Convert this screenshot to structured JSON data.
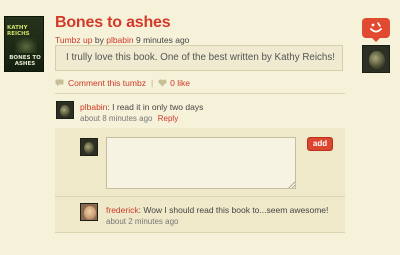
{
  "book": {
    "author_cover": "KATHY REICHS",
    "title_cover": "BONES TO ASHES"
  },
  "post": {
    "title": "Bones to ashes",
    "byline_prefix": "Tumbz up",
    "byline_by": "by",
    "byline_user": "plbabin",
    "byline_time": "9 minutes ago",
    "quote": "I trully love this book. One of the best written by Kathy Reichs!"
  },
  "actions": {
    "comment_label": "Comment this tumbz",
    "like_label": "0 like"
  },
  "comments": [
    {
      "author": "plbabin",
      "text": "I read it in only two days",
      "time": "about 8 minutes ago",
      "reply_label": "Reply"
    },
    {
      "author": "frederick",
      "text": "Wow I should read this book to...seem awesome!",
      "time": "about 2 minutes ago"
    }
  ],
  "reply_form": {
    "value": "",
    "add_label": "add"
  },
  "colors": {
    "accent": "#d43a2a",
    "background": "#f6f1d9",
    "panel": "#efe9ca"
  }
}
